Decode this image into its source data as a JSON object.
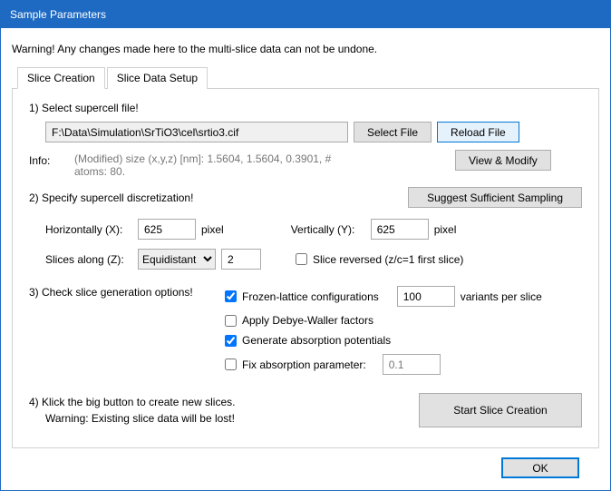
{
  "window": {
    "title": "Sample Parameters"
  },
  "warning": "Warning! Any changes made here to the multi-slice data can not be undone.",
  "tabs": {
    "creation": "Slice Creation",
    "setup": "Slice Data Setup"
  },
  "step1": {
    "label": "1) Select supercell file!",
    "path": "F:\\Data\\Simulation\\SrTiO3\\cel\\srtio3.cif",
    "select_file": "Select File",
    "reload_file": "Reload File",
    "info_label": "Info:",
    "info_text": "(Modified) size (x,y,z) [nm]: 1.5604, 1.5604, 0.3901,  # atoms: 80.",
    "view_modify": "View & Modify"
  },
  "step2": {
    "label": "2) Specify supercell discretization!",
    "suggest": "Suggest Sufficient Sampling",
    "horiz_label": "Horizontally (X):",
    "horiz_val": "625",
    "vert_label": "Vertically (Y):",
    "vert_val": "625",
    "pixel": "pixel",
    "slices_label": "Slices along (Z):",
    "slices_mode": "Equidistant",
    "slices_count": "2",
    "reversed_label": "Slice reversed (z/c=1 first slice)"
  },
  "step3": {
    "label": "3) Check slice generation options!",
    "frozen": "Frozen-lattice configurations",
    "variants_val": "100",
    "variants_label": "variants per slice",
    "dw": "Apply Debye-Waller factors",
    "absorb": "Generate absorption potentials",
    "fix": "Fix absorption parameter:",
    "fix_val": "0.1"
  },
  "step4": {
    "label": "4) Klick the big button to create new slices.",
    "warn": "Warning: Existing slice data will be lost!",
    "start": "Start Slice Creation"
  },
  "footer": {
    "ok": "OK"
  }
}
